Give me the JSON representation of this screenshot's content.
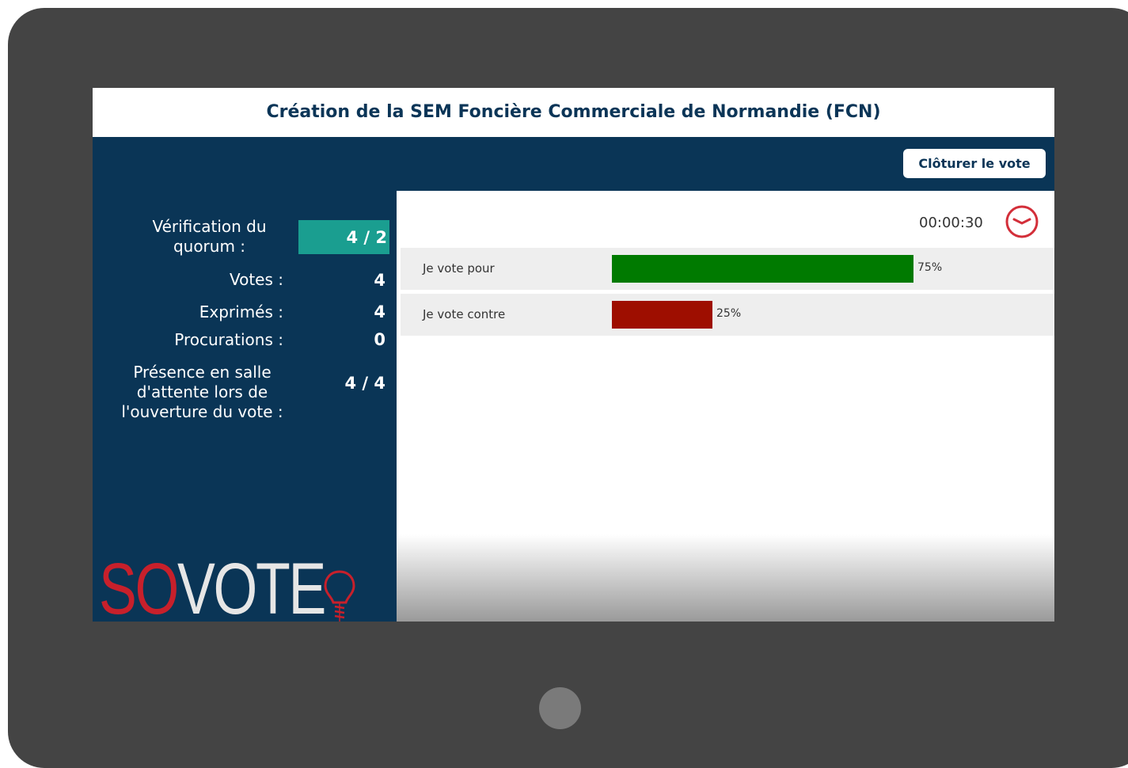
{
  "title": "Création de la SEM Foncière Commerciale de Normandie (FCN)",
  "close_vote_label": "Clôturer le vote",
  "stats": {
    "quorum_label": "Vérification du quorum :",
    "quorum_value": "4 / 2",
    "votes_label": "Votes :",
    "votes_value": "4",
    "exprimes_label": "Exprimés :",
    "exprimes_value": "4",
    "procurations_label": "Procurations :",
    "procurations_value": "0",
    "presence_label": "Présence en salle d'attente lors de l'ouverture du vote :",
    "presence_value": "4 / 4"
  },
  "logo": {
    "part1": "SO",
    "part2": "VOTE",
    "icon": "lightbulb-icon"
  },
  "timer": {
    "value": "00:00:30",
    "icon": "clock-icon"
  },
  "results": [
    {
      "label": "Je vote pour",
      "percent_label": "75%",
      "share": 0.75,
      "color": "#007a00"
    },
    {
      "label": "Je vote contre",
      "percent_label": "25%",
      "share": 0.25,
      "color": "#9e0e00"
    }
  ],
  "colors": {
    "navy": "#0a3556",
    "quorum_accent": "#1a9e90",
    "brand_red": "#c8202b",
    "device_frame": "#444444"
  }
}
